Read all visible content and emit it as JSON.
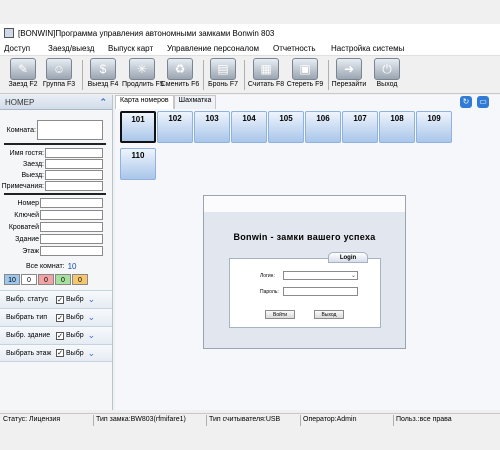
{
  "window": {
    "title": "[BONWIN]Программа управления автономными замками Bonwin 803"
  },
  "menu": [
    "Доступ",
    "Заезд/выезд",
    "Выпуск карт",
    "Управление персоналом",
    "Отчетность",
    "Настройка системы"
  ],
  "toolbar": [
    {
      "label": "Заезд F2",
      "icon": "pencil-icon"
    },
    {
      "label": "Группа F3",
      "icon": "group-icon"
    },
    {
      "label": "Выезд F4",
      "icon": "bag-icon"
    },
    {
      "label": "Продлить F5",
      "icon": "sun-icon"
    },
    {
      "label": "Сменить F6",
      "icon": "recycle-icon"
    },
    {
      "label": "Бронь F7",
      "icon": "book-icon"
    },
    {
      "label": "Считать F8",
      "icon": "reader-icon"
    },
    {
      "label": "Стереть F9",
      "icon": "eraser-icon"
    },
    {
      "label": "Перезайти",
      "icon": "relogin-icon"
    },
    {
      "label": "Выход",
      "icon": "power-icon"
    }
  ],
  "sidebar": {
    "header": "НОМЕР",
    "room_label": "Комната:",
    "guest_fields": [
      "Имя гостя:",
      "Заезд:",
      "Выезд:",
      "Примечания:"
    ],
    "room_fields": [
      "Номер",
      "Ключей",
      "Кроватей",
      "Здание",
      "Этаж"
    ],
    "total_label": "Все комнат:",
    "total_value": "10",
    "counts": [
      {
        "value": "10",
        "color": "#9ec7f0"
      },
      {
        "value": "0",
        "color": "#ffffff"
      },
      {
        "value": "0",
        "color": "#f2a3a3"
      },
      {
        "value": "0",
        "color": "#a8e0a0"
      },
      {
        "value": "0",
        "color": "#f5c870"
      }
    ],
    "selectors": [
      {
        "label": "Выбр. статус",
        "check_label": "Выбр",
        "checked": "✓"
      },
      {
        "label": "Выбрать тип",
        "check_label": "Выбр",
        "checked": "✓"
      },
      {
        "label": "Выбр. здание",
        "check_label": "Выбр",
        "checked": "✓"
      },
      {
        "label": "Выбрать этаж",
        "check_label": "Выбр",
        "checked": "✓"
      }
    ]
  },
  "main": {
    "tabs": [
      "Карта номеров",
      "Шахматка"
    ],
    "rooms": [
      "101",
      "102",
      "103",
      "104",
      "105",
      "106",
      "107",
      "108",
      "109",
      "110"
    ]
  },
  "login": {
    "slogan": "Bonwin - замки вашего успеха",
    "tab_label": "Login",
    "login_label": "Логин:",
    "password_label": "Пароль:",
    "enter_button": "Войти",
    "exit_button": "Выход"
  },
  "status": {
    "license": "Статус: Лицензия",
    "lock_type": "Тип замка:BW803(rfmifare1)",
    "reader_type": "Тип считывателя:USB",
    "operator": "Оператор:Admin",
    "user": "Польз.:все права"
  }
}
